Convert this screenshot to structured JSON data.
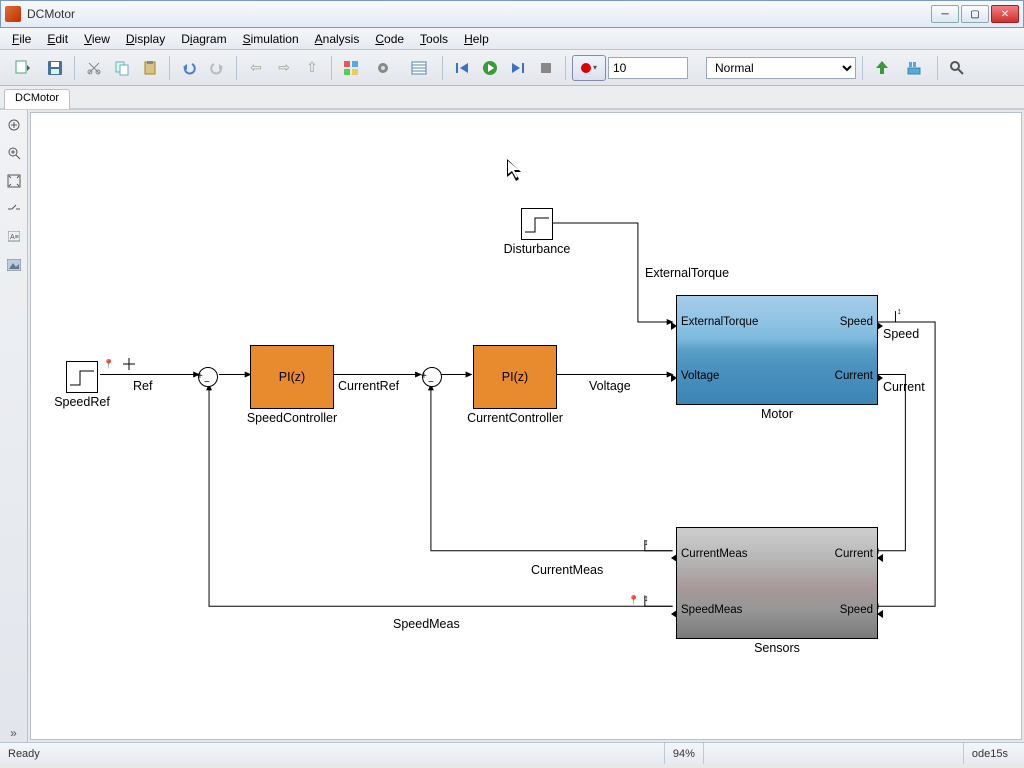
{
  "window": {
    "title": "DCMotor"
  },
  "menu": [
    "File",
    "Edit",
    "View",
    "Display",
    "Diagram",
    "Simulation",
    "Analysis",
    "Code",
    "Tools",
    "Help"
  ],
  "toolbar": {
    "stop_time": "10",
    "mode": "Normal"
  },
  "tab": {
    "name": "DCMotor"
  },
  "blocks": {
    "speedref": {
      "label": "SpeedRef"
    },
    "disturbance": {
      "label": "Disturbance"
    },
    "speedctrl": {
      "body": "PI(z)",
      "label": "SpeedController"
    },
    "currentctrl": {
      "body": "PI(z)",
      "label": "CurrentController"
    },
    "motor": {
      "label": "Motor",
      "in1": "ExternalTorque",
      "in2": "Voltage",
      "out1": "Speed",
      "out2": "Current"
    },
    "sensors": {
      "label": "Sensors",
      "out1": "CurrentMeas",
      "out2": "SpeedMeas",
      "in1": "Current",
      "in2": "Speed"
    }
  },
  "signals": {
    "ref": "Ref",
    "currentref": "CurrentRef",
    "voltage": "Voltage",
    "externaltorque": "ExternalTorque",
    "speed": "Speed",
    "current": "Current",
    "currentmeas": "CurrentMeas",
    "speedmeas": "SpeedMeas"
  },
  "status": {
    "ready": "Ready",
    "zoom": "94%",
    "solver": "ode15s"
  }
}
